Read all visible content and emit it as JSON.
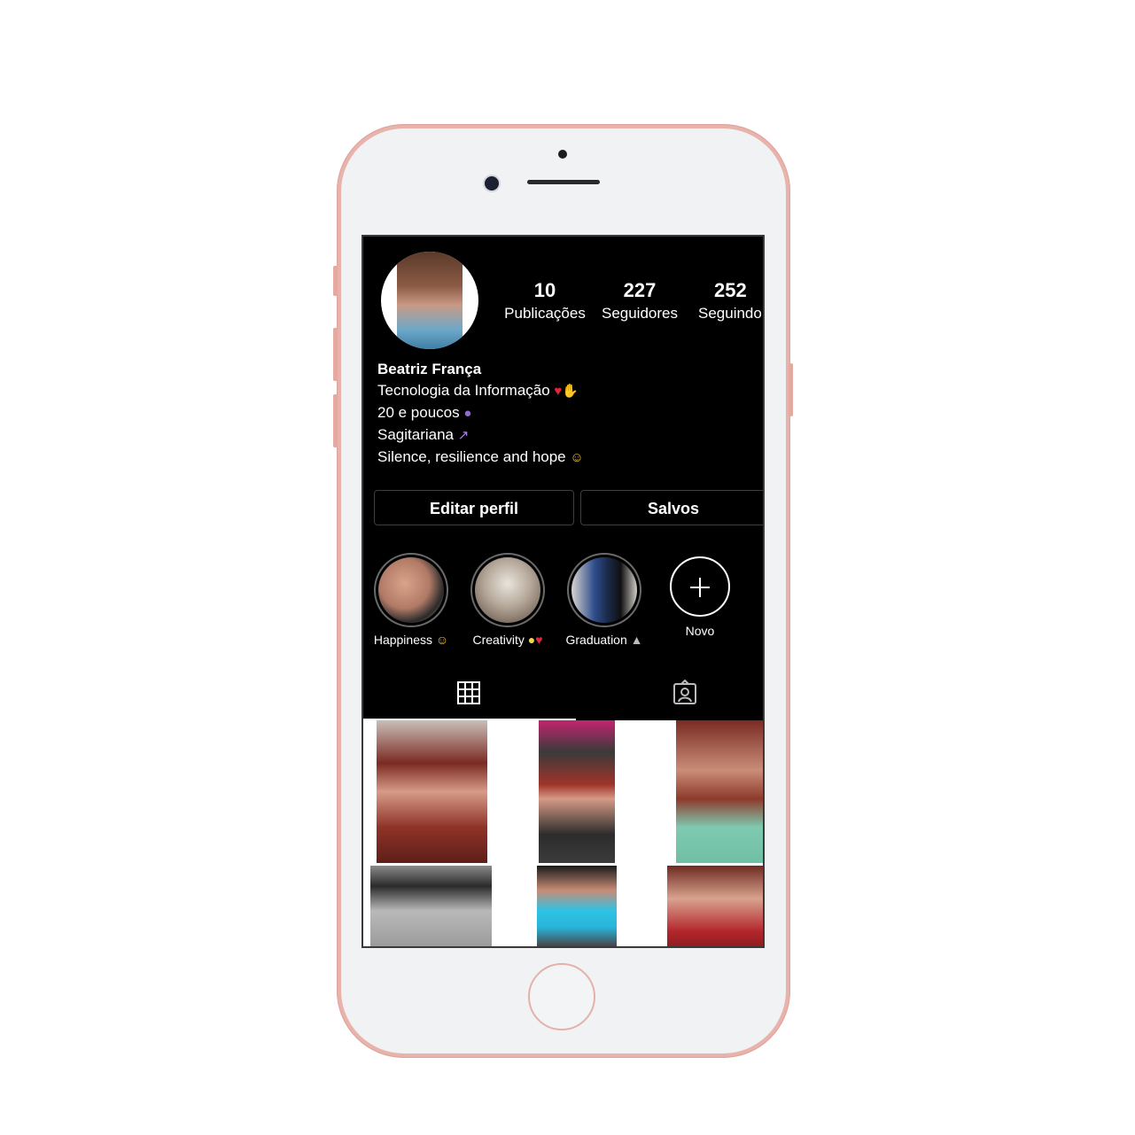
{
  "profile": {
    "name": "Beatriz França",
    "bio_lines": [
      "Tecnologia da Informação",
      "20 e poucos",
      "Sagitariana",
      "Silence, resilience and hope"
    ]
  },
  "stats": {
    "posts": {
      "value": "10",
      "label": "Publicações"
    },
    "followers": {
      "value": "227",
      "label": "Seguidores"
    },
    "following": {
      "value": "252",
      "label": "Seguindo"
    }
  },
  "buttons": {
    "edit_profile": "Editar perfil",
    "saved": "Salvos"
  },
  "highlights": [
    {
      "label": "Happiness"
    },
    {
      "label": "Creativity"
    },
    {
      "label": "Graduation"
    },
    {
      "label": "Novo"
    }
  ],
  "icons": {
    "grid_tab": "grid-icon",
    "tagged_tab": "tagged-person-icon",
    "new_highlight": "plus-icon"
  },
  "colors": {
    "background": "#000000",
    "text": "#ffffff",
    "phone_frame": "#e8b3ab"
  }
}
